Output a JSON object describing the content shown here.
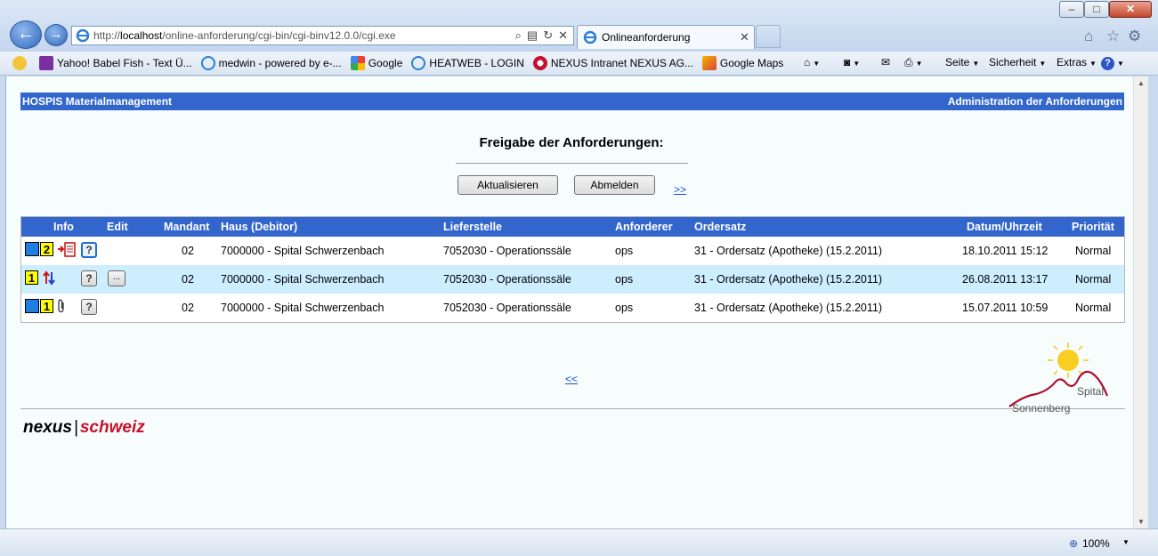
{
  "browser": {
    "url_prefix": "http://",
    "url_host": "localhost",
    "url_path": "/online-anforderung/cgi-bin/cgi-binv12.0.0/cgi.exe",
    "tab_title": "Onlineanforderung",
    "zoom": "100%",
    "favorites": [
      {
        "label": "Yahoo! Babel Fish - Text Ü..."
      },
      {
        "label": "medwin - powered by e-..."
      },
      {
        "label": "Google"
      },
      {
        "label": "HEATWEB - LOGIN"
      },
      {
        "label": "NEXUS Intranet NEXUS AG..."
      },
      {
        "label": "Google Maps"
      }
    ],
    "commands": {
      "seite": "Seite",
      "sicherheit": "Sicherheit",
      "extras": "Extras"
    }
  },
  "page": {
    "header_left": "HOSPIS Materialmanagement",
    "header_right": "Administration der Anforderungen",
    "title": "Freigabe der Anforderungen:",
    "refresh_label": "Aktualisieren",
    "logout_label": "Abmelden",
    "next_link": ">>",
    "prev_link": "<<",
    "brand_nexus": "nexus",
    "brand_bar": "|",
    "brand_schweiz": "schweiz",
    "logo_spital": "Spital",
    "logo_sonnenberg": "Sonnenberg"
  },
  "table": {
    "headers": {
      "info": "Info",
      "edit": "Edit",
      "mandant": "Mandant",
      "haus": "Haus (Debitor)",
      "lieferstelle": "Lieferstelle",
      "anforderer": "Anforderer",
      "ordersatz": "Ordersatz",
      "datum": "Datum/Uhrzeit",
      "prioritaet": "Priorität"
    },
    "rows": [
      {
        "badge": "2",
        "help": "?",
        "edit": "",
        "mandant": "02",
        "haus": "7000000 - Spital Schwerzenbach",
        "lieferstelle": "7052030 - Operationssäle",
        "anforderer": "ops",
        "ordersatz": "31 - Ordersatz (Apotheke) (15.2.2011)",
        "datum": "18.10.2011 15:12",
        "prioritaet": "Normal"
      },
      {
        "badge": "1",
        "help": "?",
        "edit": "...",
        "mandant": "02",
        "haus": "7000000 - Spital Schwerzenbach",
        "lieferstelle": "7052030 - Operationssäle",
        "anforderer": "ops",
        "ordersatz": "31 - Ordersatz (Apotheke) (15.2.2011)",
        "datum": "26.08.2011 13:17",
        "prioritaet": "Normal"
      },
      {
        "badge": "1",
        "help": "?",
        "edit": "",
        "mandant": "02",
        "haus": "7000000 - Spital Schwerzenbach",
        "lieferstelle": "7052030 - Operationssäle",
        "anforderer": "ops",
        "ordersatz": "31 - Ordersatz (Apotheke) (15.2.2011)",
        "datum": "15.07.2011 10:59",
        "prioritaet": "Normal"
      }
    ]
  },
  "colors": {
    "header_blue": "#3366cc",
    "row_alt": "#cceeff",
    "brand_red": "#c8102e"
  }
}
